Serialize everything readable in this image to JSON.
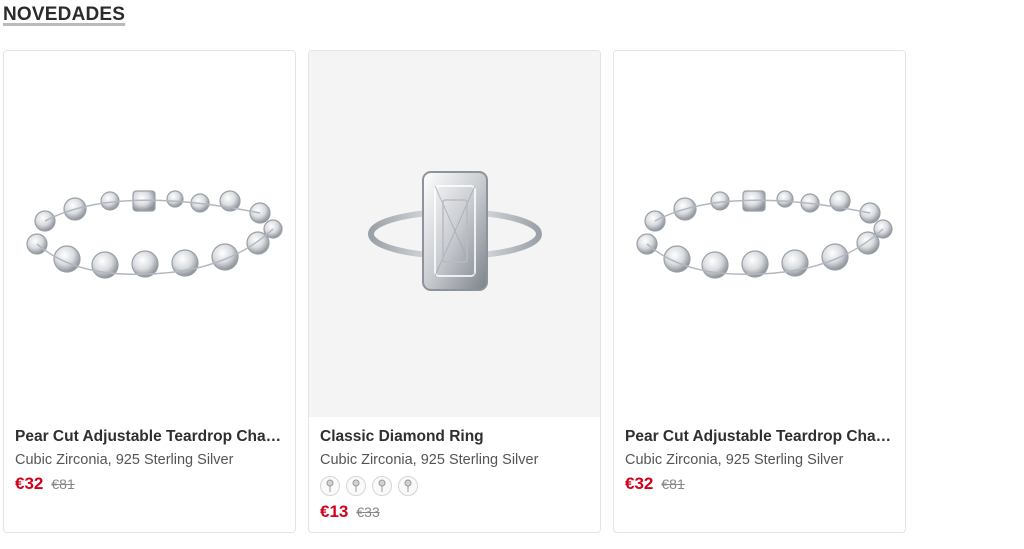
{
  "section": {
    "title": "NOVEDADES"
  },
  "products": [
    {
      "name": "Pear Cut Adjustable Teardrop Chain Bracelet",
      "material": "Cubic Zirconia, 925 Sterling Silver",
      "price": "€32",
      "old_price": "€81",
      "image": "bracelet-image"
    },
    {
      "name": "Classic Diamond Ring",
      "material": "Cubic Zirconia, 925 Sterling Silver",
      "price": "€13",
      "old_price": "€33",
      "image": "ring-image",
      "swatch_count": 4
    },
    {
      "name": "Pear Cut Adjustable Teardrop Chain Bracelet",
      "material": "Cubic Zirconia, 925 Sterling Silver",
      "price": "€32",
      "old_price": "€81",
      "image": "bracelet-image"
    }
  ]
}
